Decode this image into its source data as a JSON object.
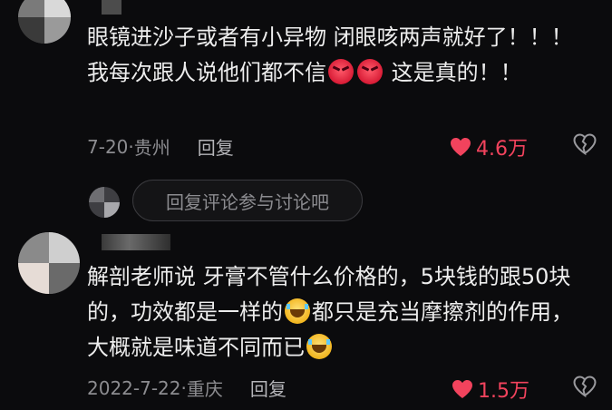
{
  "comments": [
    {
      "text_parts": [
        "眼镜进沙子或者有小异物 闭眼咳两声就好了！！！ 我每次跟人说他们都不信",
        " 这是真的！！"
      ],
      "emojis": [
        "angry-face-emoji",
        "angry-face-emoji"
      ],
      "date": "7-20",
      "location": "贵州",
      "reply_label": "回复",
      "likes": "4.6万"
    },
    {
      "text_parts": [
        "解剖老师说 牙膏不管什么价格的，5块钱的跟50块的，功效都是一样的",
        "都只是充当摩擦剂的作用，大概就是味道不同而已"
      ],
      "emojis": [
        "laughing-crying-emoji",
        "laughing-crying-emoji"
      ],
      "date": "2022-7-22",
      "location": "重庆",
      "reply_label": "回复",
      "likes": "1.5万"
    }
  ],
  "reply_prompt": "回复评论参与讨论吧",
  "dot": "·",
  "colors": {
    "like": "#f2435d",
    "background": "#0b0b0d",
    "meta": "#8c8c90"
  },
  "icons": {
    "like": "heart-icon",
    "dislike": "broken-heart-icon"
  }
}
